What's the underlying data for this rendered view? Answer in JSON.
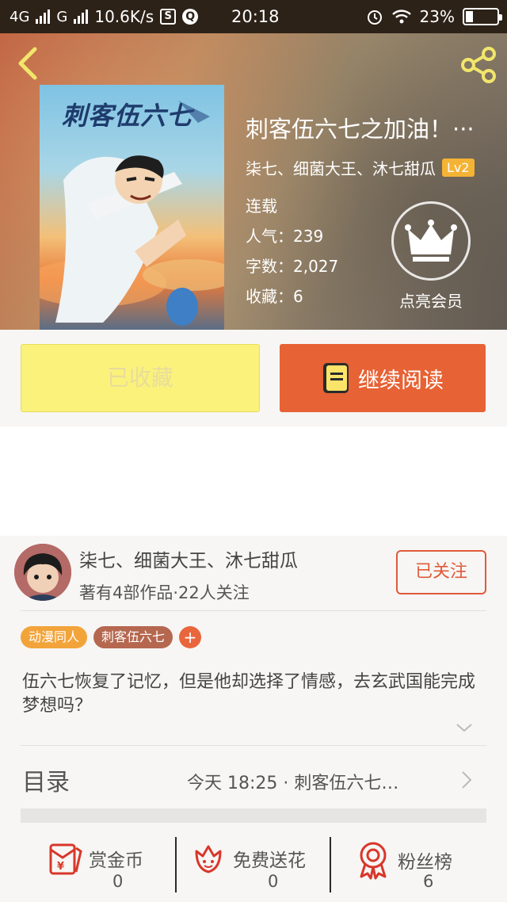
{
  "status_bar": {
    "net1": "4G",
    "net2": "G",
    "speed": "10.6K/s",
    "box_icon_letter": "S",
    "q_icon_letter": "Q",
    "time": "20:18",
    "battery": "23%",
    "battery_level": 0.23
  },
  "book": {
    "title": "刺客伍六七之加油！···",
    "authors": "柒七、细菌大王、沐七甜瓜",
    "level": "Lv2",
    "status": "连载",
    "popularity": "人气：239",
    "word_count": "字数：2,027",
    "favorites": "收藏：6",
    "vip_label": "点亮会员",
    "cover_text": "刺客伍六七"
  },
  "actions": {
    "collected_label": "已收藏",
    "read_label": "继续阅读"
  },
  "author": {
    "name": "柒七、细菌大王、沐七甜瓜",
    "stats": "著有4部作品·22人关注",
    "follow_label": "已关注"
  },
  "tags": [
    {
      "label": "动漫同人",
      "color": "#f2a43a"
    },
    {
      "label": "刺客伍六七",
      "color": "#b5674f"
    }
  ],
  "tag_add": "+",
  "description": "伍六七恢复了记忆，但是他却选择了情感，去玄武国能完成梦想吗？",
  "toc": {
    "label": "目录",
    "latest": "今天 18:25 · 刺客伍六七…"
  },
  "bottom_bar": [
    {
      "label": "赏金币",
      "count": "0",
      "icon": "red-envelope-icon"
    },
    {
      "label": "免费送花",
      "count": "0",
      "icon": "flower-icon"
    },
    {
      "label": "粉丝榜",
      "count": "6",
      "icon": "medal-icon"
    }
  ],
  "colors": {
    "accent": "#e76234",
    "collected_bg": "#fbf27c",
    "icon_red": "#d8372a"
  }
}
